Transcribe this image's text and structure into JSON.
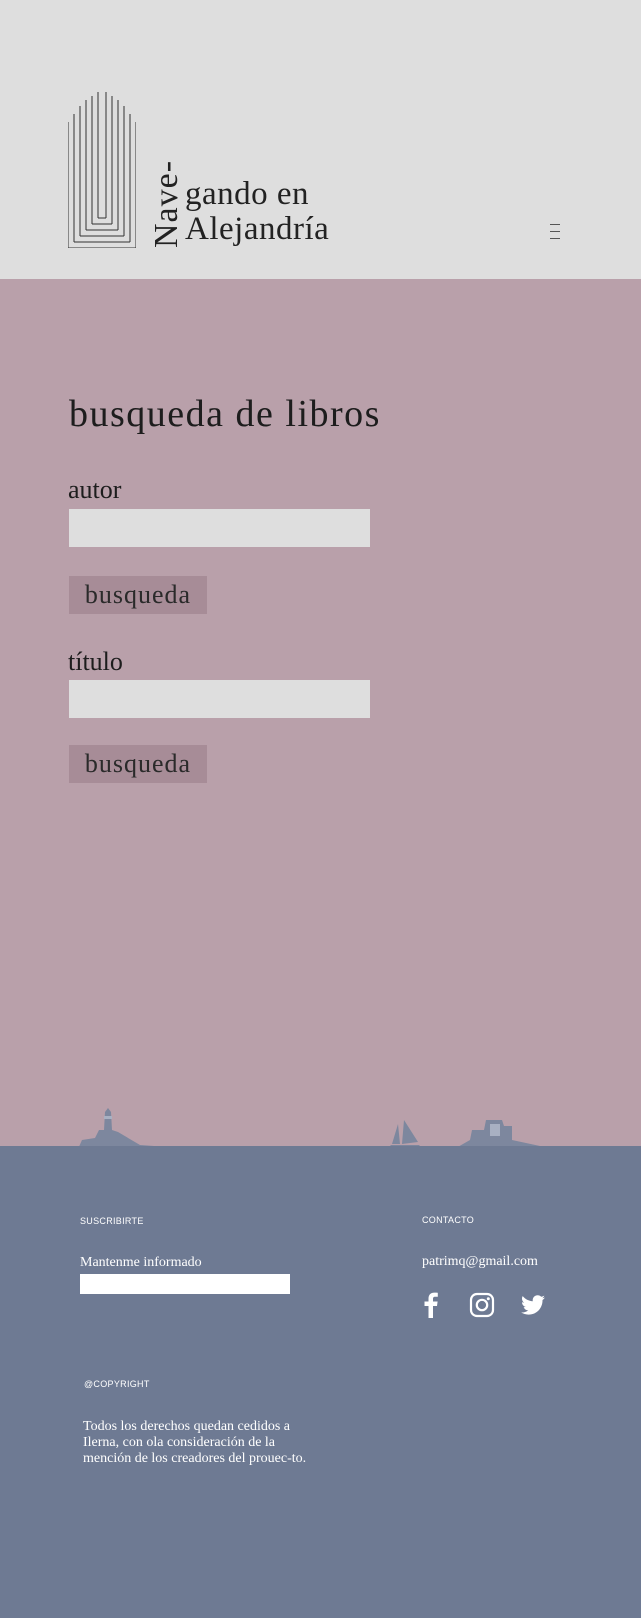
{
  "header": {
    "logo_vertical": "Nave-",
    "logo_line1": "gando en",
    "logo_line2": "Alejandría",
    "logo_icon": "nested-arches-logo",
    "menu_icon": "hamburger-menu-icon"
  },
  "main": {
    "title": "busqueda de libros",
    "author": {
      "label": "autor",
      "value": "",
      "button_label": "busqueda"
    },
    "title_field": {
      "label": "título",
      "value": "",
      "button_label": "busqueda"
    }
  },
  "footer": {
    "subscribe_heading": "SUSCRIBIRTE",
    "newsletter_label": "Mantenme informado",
    "newsletter_value": "",
    "contact_heading": "CONTACTO",
    "contact_email": "patrimq@gmail.com",
    "social": [
      "facebook-icon",
      "instagram-icon",
      "twitter-icon"
    ],
    "copyright_heading": "@COPYRIGHT",
    "legal_text": "Todos los derechos quedan cedidos a Ilerna, con ola consideración de la mención de los creadores del prouec-to."
  },
  "colors": {
    "header_bg": "#dedede",
    "main_bg": "#b9a0aa",
    "button_bg": "#a78c97",
    "footer_bg": "#6e7a93",
    "silhouette": "#7d879e"
  }
}
